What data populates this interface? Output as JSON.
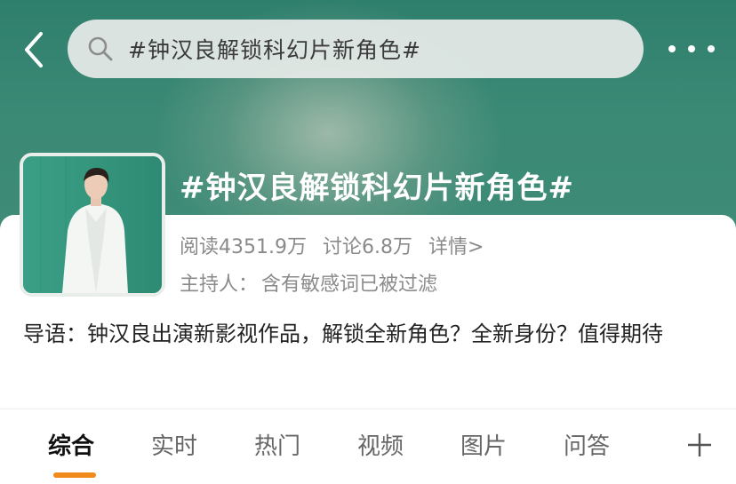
{
  "header": {
    "search_query": "#钟汉良解锁科幻片新角色#",
    "back_icon": "chevron-left-icon",
    "search_icon": "search-icon",
    "more_icon": "more-horizontal-icon"
  },
  "topic": {
    "title": "#钟汉良解锁科幻片新角色#",
    "stats": {
      "reads": "阅读4351.9万",
      "discussions": "讨论6.8万",
      "details": "详情>"
    },
    "host_label": "主持人：",
    "host_value": "含有敏感词已被过滤",
    "intro": "导语：钟汉良出演新影视作品，解锁全新角色？全新身份？值得期待"
  },
  "tabs": [
    {
      "label": "综合",
      "active": true
    },
    {
      "label": "实时",
      "active": false
    },
    {
      "label": "热门",
      "active": false
    },
    {
      "label": "视频",
      "active": false
    },
    {
      "label": "图片",
      "active": false
    },
    {
      "label": "问答",
      "active": false
    }
  ],
  "tab_add_icon": "plus-icon",
  "colors": {
    "header_green": "#3b8a76",
    "active_tab_indicator": "#f08a1d",
    "muted_text": "#8a8a8a"
  }
}
